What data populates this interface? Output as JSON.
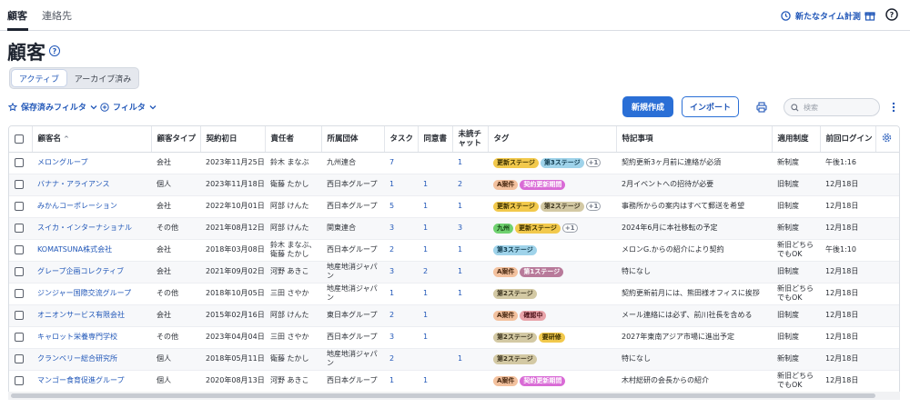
{
  "nav": {
    "tabs": [
      "顧客",
      "連絡先"
    ],
    "time_button": "新たなタイム計測"
  },
  "page": {
    "title": "顧客",
    "help": "?"
  },
  "segment": {
    "active": "アクティブ",
    "archived": "アーカイブ済み"
  },
  "toolbar": {
    "saved_filters": "保存済みフィルタ",
    "filter": "フィルタ",
    "new_button": "新規作成",
    "import_button": "インポート",
    "search_placeholder": "検索"
  },
  "table": {
    "headers": [
      "顧客名",
      "顧客タイプ",
      "契約初日",
      "責任者",
      "所属団体",
      "タスク",
      "同意書",
      "未読チャット",
      "タグ",
      "特記事項",
      "適用制度",
      "前回ログイン"
    ],
    "sort_indicator": "^",
    "rows": [
      {
        "name": "メロングループ",
        "type": "会社",
        "date": "2023年11月25日",
        "owner": "鈴木 まなぶ",
        "org": "九州連合",
        "tasks": "7",
        "consent": "",
        "unread": "1",
        "tags": [
          {
            "label": "更新ステージ",
            "color": "yellow"
          },
          {
            "label": "第3ステージ",
            "color": "sky"
          }
        ],
        "more": "+1",
        "note": "契約更新3ヶ月前に連絡が必須",
        "system": "新制度",
        "login": "午後1:16"
      },
      {
        "name": "バナナ・アライアンス",
        "type": "個人",
        "date": "2023年11月18日",
        "owner": "衛藤 たかし",
        "org": "西日本グループ",
        "tasks": "1",
        "consent": "1",
        "unread": "2",
        "tags": [
          {
            "label": "A案件",
            "color": "peach"
          },
          {
            "label": "契約更新期間",
            "color": "magenta"
          }
        ],
        "more": "",
        "note": "2月イベントへの招待が必要",
        "system": "旧制度",
        "login": "12月18日"
      },
      {
        "name": "みかんコーポレーション",
        "type": "会社",
        "date": "2022年10月01日",
        "owner": "阿部 けんた",
        "org": "西日本グループ",
        "tasks": "5",
        "consent": "1",
        "unread": "1",
        "tags": [
          {
            "label": "更新ステージ",
            "color": "yellow"
          },
          {
            "label": "第2ステージ",
            "color": "khaki"
          }
        ],
        "more": "+1",
        "note": "事務所からの案内はすべて郵送を希望",
        "system": "旧制度",
        "login": "12月18日"
      },
      {
        "name": "スイカ・インターナショナル",
        "type": "その他",
        "date": "2021年08月12日",
        "owner": "阿部 けんた",
        "org": "関東連合",
        "tasks": "3",
        "consent": "1",
        "unread": "3",
        "tags": [
          {
            "label": "九州",
            "color": "green"
          },
          {
            "label": "更新ステージ",
            "color": "yellow"
          }
        ],
        "more": "+1",
        "note": "2024年6月に本社移転の予定",
        "system": "新制度",
        "login": "12月18日"
      },
      {
        "name": "KOMATSUNA株式会社",
        "type": "会社",
        "date": "2018年03月08日",
        "owner": "鈴木 まなぶ、衛藤 たかし",
        "org": "西日本グループ",
        "tasks": "2",
        "consent": "1",
        "unread": "1",
        "tags": [
          {
            "label": "第3ステージ",
            "color": "sky"
          }
        ],
        "more": "",
        "note": "メロンG.からの紹介により契約",
        "system": "新旧どちらでもOK",
        "login": "午後1:10"
      },
      {
        "name": "グレープ企画コレクティブ",
        "type": "会社",
        "date": "2021年09月02日",
        "owner": "河野 あきこ",
        "org": "地産地消ジャパン",
        "tasks": "3",
        "consent": "2",
        "unread": "1",
        "tags": [
          {
            "label": "A案件",
            "color": "peach"
          },
          {
            "label": "第1ステージ",
            "color": "plum"
          }
        ],
        "more": "",
        "note": "特になし",
        "system": "旧制度",
        "login": "12月18日"
      },
      {
        "name": "ジンジャー国際交流グループ",
        "type": "その他",
        "date": "2018年10月05日",
        "owner": "三田 さやか",
        "org": "地産地消ジャパン",
        "tasks": "1",
        "consent": "1",
        "unread": "1",
        "tags": [
          {
            "label": "第2ステージ",
            "color": "khaki"
          }
        ],
        "more": "",
        "note": "契約更新前月には、熊田様オフィスに挨拶",
        "system": "新旧どちらでもOK",
        "login": "12月18日"
      },
      {
        "name": "オニオンサービス有限会社",
        "type": "会社",
        "date": "2015年02月16日",
        "owner": "阿部 けんた",
        "org": "東日本グループ",
        "tasks": "2",
        "consent": "1",
        "unread": "",
        "tags": [
          {
            "label": "A案件",
            "color": "peach"
          },
          {
            "label": "確認中",
            "color": "rose"
          }
        ],
        "more": "",
        "note": "メール連絡には必ず、前川社長を含める",
        "system": "旧制度",
        "login": "12月18日"
      },
      {
        "name": "キャロット栄養専門学校",
        "type": "その他",
        "date": "2023年04月04日",
        "owner": "三田 さやか",
        "org": "西日本グループ",
        "tasks": "3",
        "consent": "1",
        "unread": "",
        "tags": [
          {
            "label": "第2ステージ",
            "color": "khaki"
          },
          {
            "label": "要研修",
            "color": "yellow"
          }
        ],
        "more": "",
        "note": "2027年東南アジア市場に進出予定",
        "system": "旧制度",
        "login": "12月18日"
      },
      {
        "name": "クランベリー総合研究所",
        "type": "個人",
        "date": "2018年05月11日",
        "owner": "衛藤 たかし",
        "org": "地産地消ジャパン",
        "tasks": "2",
        "consent": "",
        "unread": "1",
        "tags": [
          {
            "label": "第2ステージ",
            "color": "khaki"
          }
        ],
        "more": "",
        "note": "特になし",
        "system": "新制度",
        "login": "12月18日"
      },
      {
        "name": "マンゴー食育促進グループ",
        "type": "個人",
        "date": "2020年08月13日",
        "owner": "河野 あきこ",
        "org": "西日本グループ",
        "tasks": "1",
        "consent": "1",
        "unread": "",
        "tags": [
          {
            "label": "A案件",
            "color": "peach"
          },
          {
            "label": "契約更新期間",
            "color": "magenta"
          }
        ],
        "more": "",
        "note": "木村総研の会長からの紹介",
        "system": "新旧どちらでもOK",
        "login": "12月18日"
      }
    ]
  },
  "colors": {
    "accent": "#2157b8",
    "primary_button": "#2a6fd6",
    "tag_yellow": "#f2c94c",
    "tag_sky": "#9fd3ea",
    "tag_khaki": "#d3c9a4",
    "tag_peach": "#f3c19e",
    "tag_magenta": "#d96bd6",
    "tag_green": "#6fd16f",
    "tag_plum": "#b87a9a",
    "tag_rose": "#e8a3a9"
  }
}
